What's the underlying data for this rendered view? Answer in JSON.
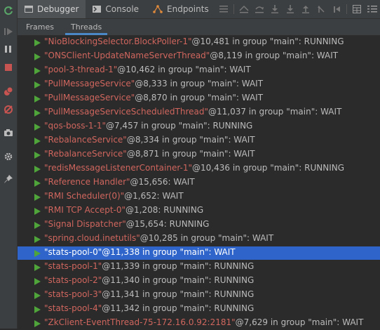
{
  "toolbar": {
    "tabs": [
      {
        "label": "Debugger",
        "icon": "debugger-icon"
      },
      {
        "label": "Console",
        "icon": "console-icon"
      },
      {
        "label": "Endpoints",
        "icon": "endpoints-icon"
      }
    ]
  },
  "subtabs": [
    {
      "label": "Frames",
      "active": false
    },
    {
      "label": "Threads",
      "active": true
    }
  ],
  "threads": [
    {
      "name": "\"NioBlockingSelector.BlockPoller-1\"",
      "info": "@10,481 in group \"main\": RUNNING",
      "selected": false
    },
    {
      "name": "\"ONSClient-UpdateNameServerThread\"",
      "info": "@8,119 in group \"main\": WAIT",
      "selected": false
    },
    {
      "name": "\"pool-3-thread-1\"",
      "info": "@10,462 in group \"main\": WAIT",
      "selected": false
    },
    {
      "name": "\"PullMessageService\"",
      "info": "@8,333 in group \"main\": WAIT",
      "selected": false
    },
    {
      "name": "\"PullMessageService\"",
      "info": "@8,870 in group \"main\": WAIT",
      "selected": false
    },
    {
      "name": "\"PullMessageServiceScheduledThread\"",
      "info": "@11,037 in group \"main\": WAIT",
      "selected": false
    },
    {
      "name": "\"qos-boss-1-1\"",
      "info": "@7,457 in group \"main\": RUNNING",
      "selected": false
    },
    {
      "name": "\"RebalanceService\"",
      "info": "@8,334 in group \"main\": WAIT",
      "selected": false
    },
    {
      "name": "\"RebalanceService\"",
      "info": "@8,871 in group \"main\": WAIT",
      "selected": false
    },
    {
      "name": "\"redisMessageListenerContainer-1\"",
      "info": "@10,436 in group \"main\": RUNNING",
      "selected": false
    },
    {
      "name": "\"Reference Handler\"",
      "info": "@15,656: WAIT",
      "selected": false
    },
    {
      "name": "\"RMI Scheduler(0)\"",
      "info": "@1,652: WAIT",
      "selected": false
    },
    {
      "name": "\"RMI TCP Accept-0\"",
      "info": "@1,208: RUNNING",
      "selected": false
    },
    {
      "name": "\"Signal Dispatcher\"",
      "info": "@15,654: RUNNING",
      "selected": false
    },
    {
      "name": "\"spring.cloud.inetutils\"",
      "info": "@10,285 in group \"main\": WAIT",
      "selected": false
    },
    {
      "name": "\"stats-pool-0\"",
      "info": "@11,338 in group \"main\": WAIT",
      "selected": true
    },
    {
      "name": "\"stats-pool-1\"",
      "info": "@11,339 in group \"main\": RUNNING",
      "selected": false
    },
    {
      "name": "\"stats-pool-2\"",
      "info": "@11,340 in group \"main\": RUNNING",
      "selected": false
    },
    {
      "name": "\"stats-pool-3\"",
      "info": "@11,341 in group \"main\": RUNNING",
      "selected": false
    },
    {
      "name": "\"stats-pool-4\"",
      "info": "@11,342 in group \"main\": RUNNING",
      "selected": false
    },
    {
      "name": "\"ZkClient-EventThread-75-172.16.0.92:2181\"",
      "info": "@7,629 in group \"main\": WAIT",
      "selected": false
    }
  ]
}
